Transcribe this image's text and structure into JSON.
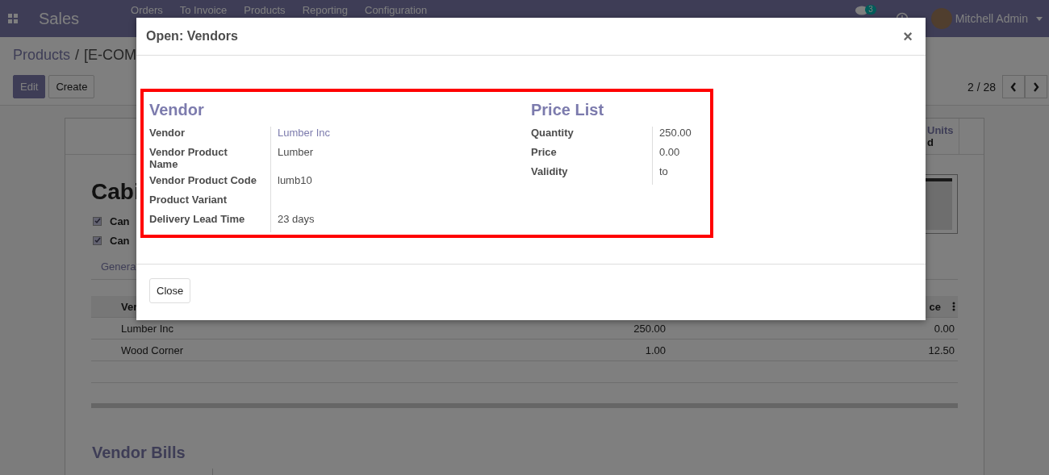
{
  "navbar": {
    "app_name": "Sales",
    "menu": [
      "Orders",
      "To Invoice",
      "Products",
      "Reporting",
      "Configuration"
    ],
    "chat_count": "3",
    "user_name": "Mitchell Admin"
  },
  "control_panel": {
    "breadcrumb": [
      "Products",
      "[E-COM"
    ],
    "breadcrumb_separator": "/",
    "buttons": [
      {
        "label": "Edit",
        "kind": "primary"
      },
      {
        "label": "Create",
        "kind": "secondary"
      }
    ],
    "pager": "2 / 28"
  },
  "form": {
    "stat_button": {
      "value": "Units",
      "line_2": "d"
    },
    "title": "Cabi",
    "checkboxes": [
      {
        "label": "Can",
        "checked": true
      },
      {
        "label": "Can",
        "checked": true
      }
    ],
    "tabs": [
      {
        "label": "Genera",
        "selected": false
      }
    ],
    "vendor_table": {
      "columns": [
        "Ver",
        "ce"
      ],
      "rows": [
        {
          "vendor": "Lumber Inc",
          "quantity": "250.00",
          "price": "0.00"
        },
        {
          "vendor": "Wood Corner",
          "quantity": "1.00",
          "price": "12.50"
        }
      ]
    },
    "section_title": "Vendor Bills"
  },
  "dialog": {
    "title": "Open: Vendors",
    "close_symbol": "×",
    "groups": [
      {
        "heading": "Vendor",
        "fields": [
          {
            "label": "Vendor",
            "value": "Lumber Inc",
            "kind": "link"
          },
          {
            "label": "Vendor Product Name",
            "value": "Lumber",
            "kind": "text"
          },
          {
            "label": "Vendor Product Code",
            "value": "lumb10",
            "kind": "text"
          },
          {
            "label": "Product Variant",
            "kind": "text"
          },
          {
            "label": "Delivery Lead Time",
            "value": "23 days",
            "kind": "text"
          }
        ]
      },
      {
        "heading": "Price List",
        "fields": [
          {
            "label": "Quantity",
            "value": "250.00",
            "kind": "text"
          },
          {
            "label": "Price",
            "value": "0.00",
            "kind": "text"
          },
          {
            "label": "Validity",
            "value": "to",
            "kind": "text"
          }
        ]
      }
    ],
    "highlighted": true,
    "footer_button": "Close"
  }
}
